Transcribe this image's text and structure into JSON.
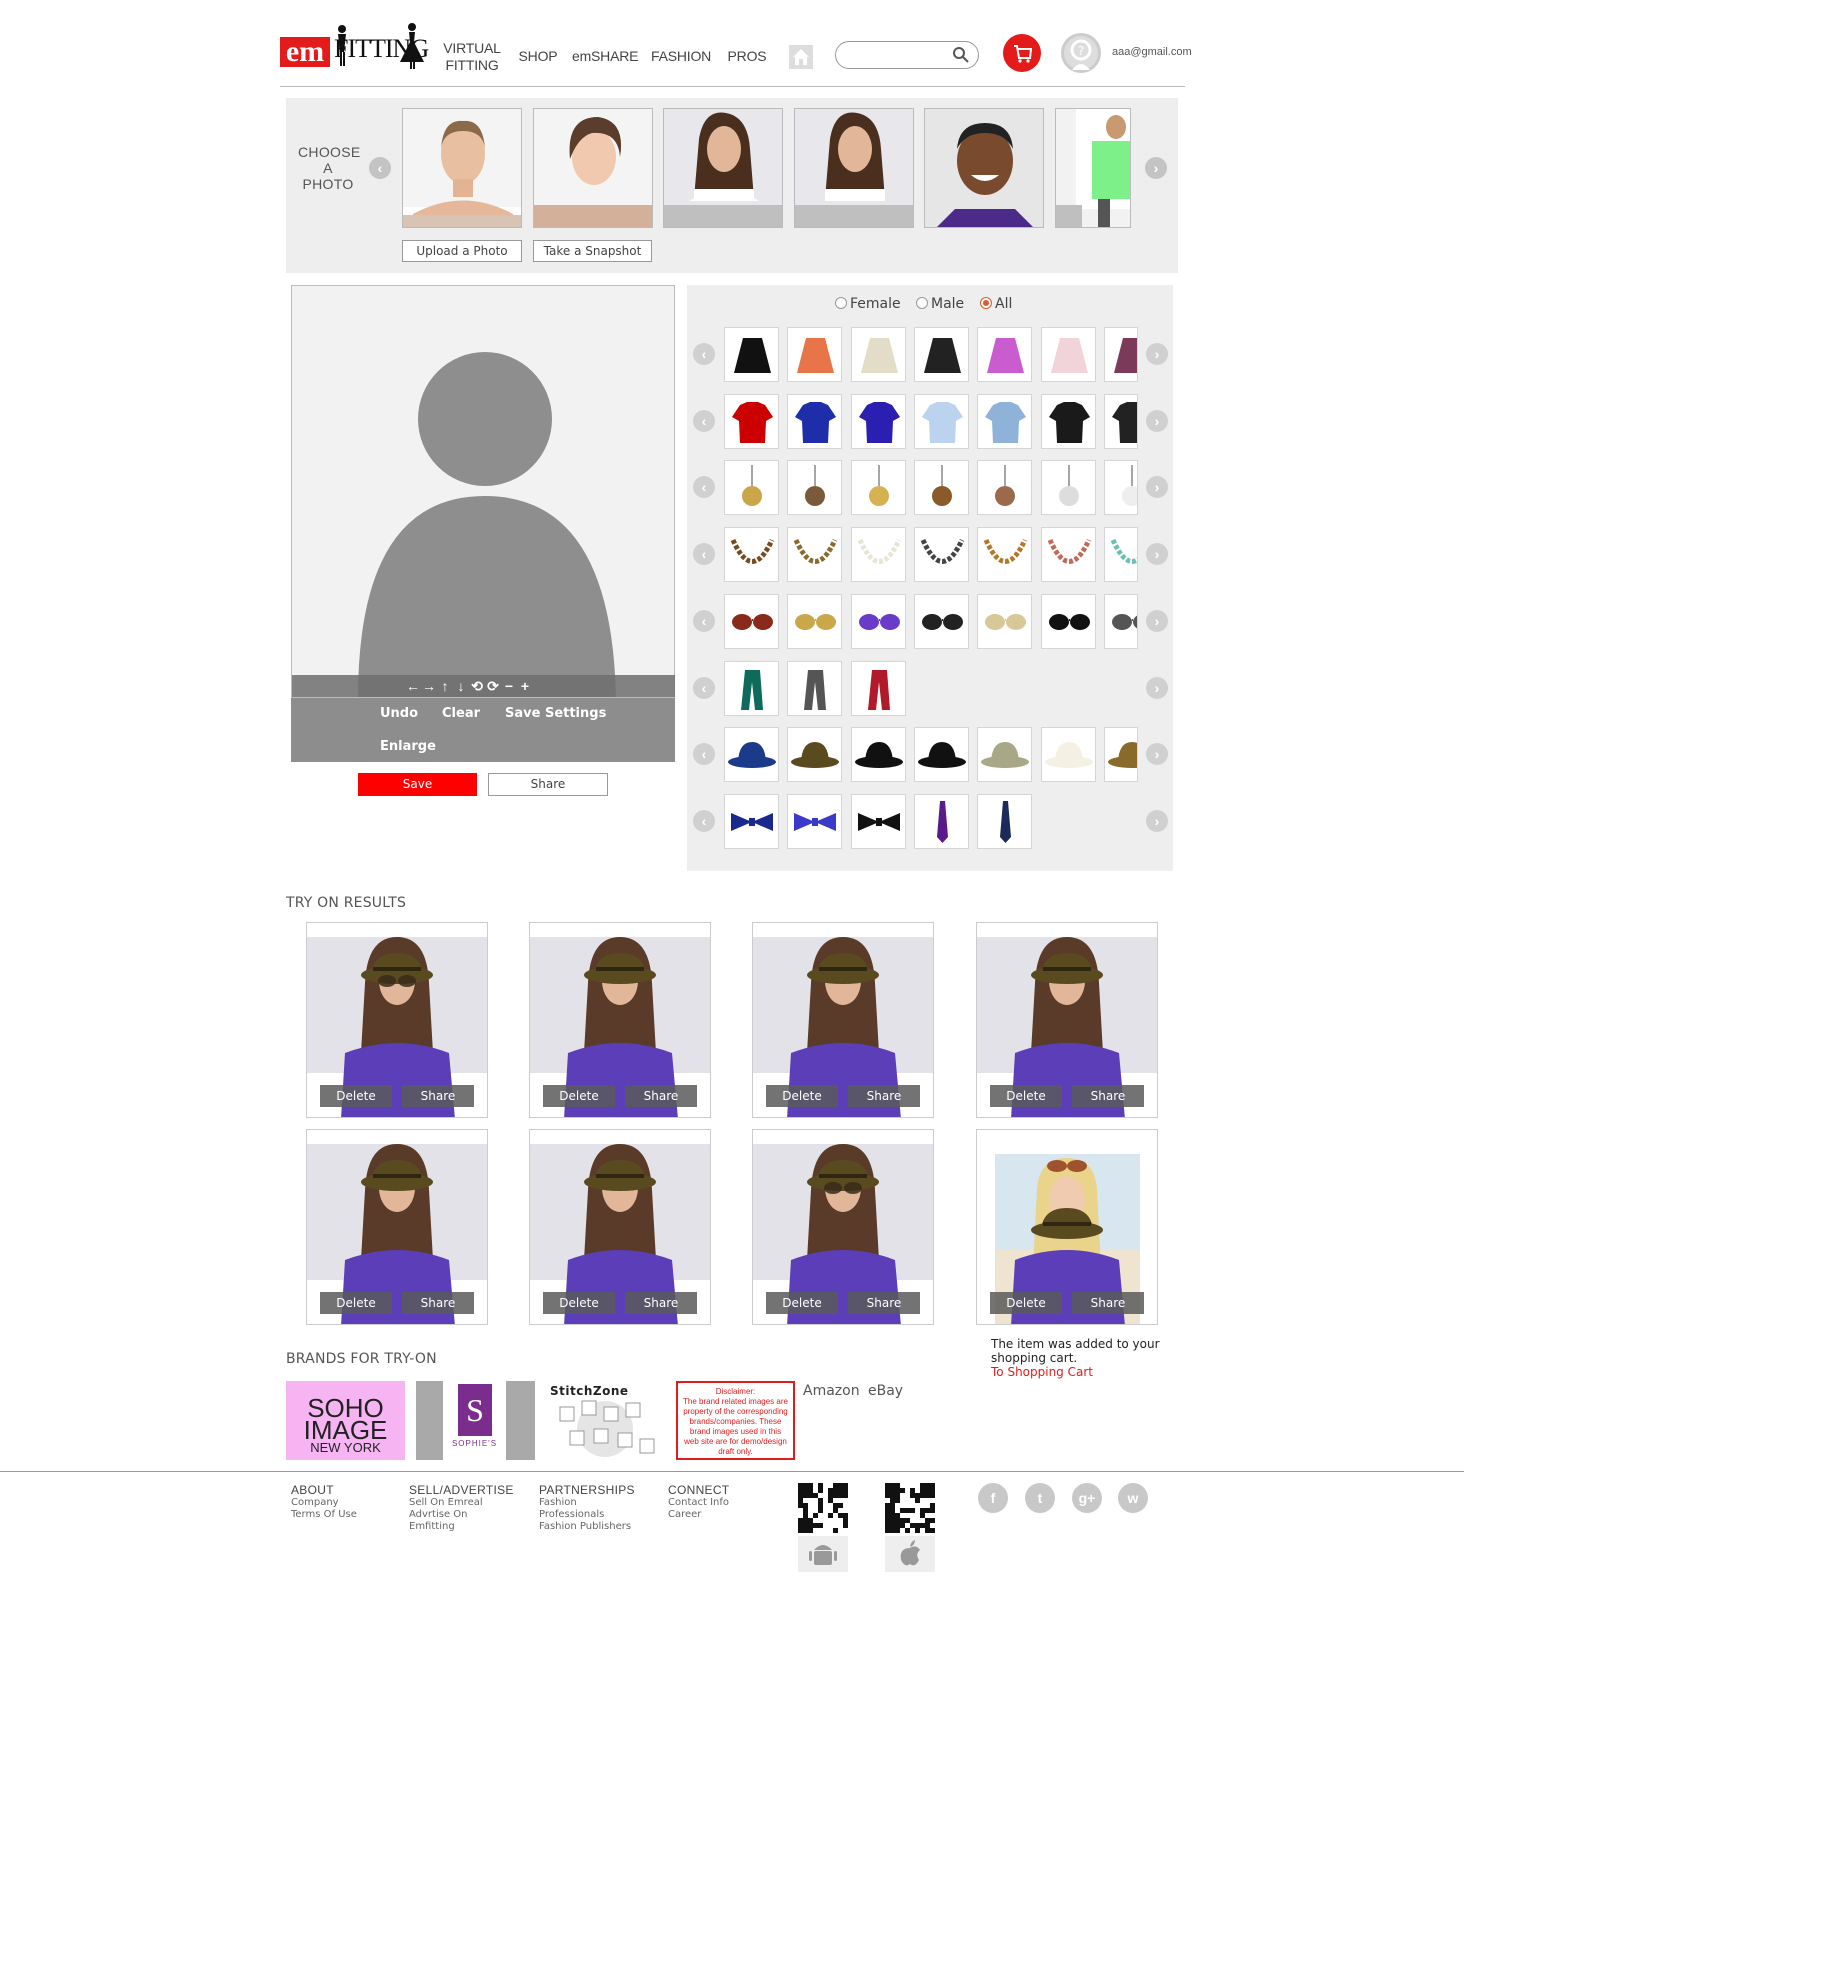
{
  "header": {
    "logo_em": "em",
    "logo_fitting": "FITTING",
    "nav": [
      {
        "label_line1": "VIRTUAL",
        "label_line2": "FITTING"
      },
      {
        "label_line1": "SHOP",
        "label_line2": ""
      },
      {
        "label_line1": "emSHARE",
        "label_line2": ""
      },
      {
        "label_line1": "FASHION",
        "label_line2": ""
      },
      {
        "label_line1": "PROS",
        "label_line2": ""
      }
    ],
    "search_placeholder": "",
    "user_email": "aaa@gmail.com",
    "icons": {
      "home": "home-icon",
      "search": "search-icon",
      "cart": "cart-icon",
      "avatar": "user-icon"
    }
  },
  "photo_chooser": {
    "label_line1": "CHOOSE",
    "label_line2": "A",
    "label_line3": "PHOTO",
    "upload_label": "Upload a Photo",
    "snapshot_label": "Take a Snapshot",
    "photos": [
      "woman-portrait",
      "woman-short-hair",
      "woman-long-hair",
      "woman-long-hair-2",
      "man-smiling",
      "man-green-shirt"
    ]
  },
  "canvas": {
    "placeholder": "person-silhouette",
    "tools": [
      "←",
      "→",
      "↑",
      "↓",
      "⟲",
      "⟳",
      "−",
      "+"
    ],
    "undo_label": "Undo",
    "clear_label": "Clear",
    "save_settings_label": "Save Settings",
    "enlarge_label": "Enlarge",
    "save_label": "Save",
    "share_label": "Share"
  },
  "catalog": {
    "gender_options": [
      {
        "label": "Female",
        "selected": false
      },
      {
        "label": "Male",
        "selected": false
      },
      {
        "label": "All",
        "selected": true
      }
    ],
    "rows": [
      {
        "category": "skirts",
        "items": [
          "black-skirt",
          "orange-floral-skirt",
          "lace-skirt",
          "black-pleated-skirt",
          "striped-skirt",
          "pink-floral-skirt",
          "patterned-skirt"
        ]
      },
      {
        "category": "tops",
        "items": [
          "red-tshirt",
          "blue-jacket",
          "blue-top",
          "light-blue-shirt",
          "blue-denim-shirt",
          "black-suit",
          "black-suit-2"
        ]
      },
      {
        "category": "earrings",
        "items": [
          "gold-pearl-earring",
          "bronze-pearl-earring",
          "gold-pearl-earring-2",
          "bronze-pearl-earring-2",
          "copper-pearl-earring",
          "white-pearl-earring",
          "pearl-drop-earring"
        ]
      },
      {
        "category": "necklaces",
        "items": [
          "brown-bead-necklace",
          "bronze-bead-necklace",
          "pearl-necklace",
          "jeweled-necklace",
          "gold-flower-necklace",
          "pink-stone-necklace",
          "turquoise-necklace"
        ]
      },
      {
        "category": "sunglasses",
        "items": [
          "tortoise-sunglasses",
          "aviator-sunglasses",
          "purple-sunglasses",
          "black-cat-eye-sunglasses",
          "white-sunglasses",
          "black-sunglasses",
          "studded-sunglasses"
        ]
      },
      {
        "category": "scarves",
        "items": [
          "green-plaid-scarf",
          "grey-scarf",
          "red-plaid-scarf"
        ]
      },
      {
        "category": "hats",
        "items": [
          "blue-cap",
          "olive-porkpie-hat",
          "black-chanel-cap",
          "black-wide-brim-hat",
          "beige-sun-hat",
          "white-fedora",
          "straw-fedora"
        ]
      },
      {
        "category": "ties",
        "items": [
          "flag-bow-tie",
          "plaid-bow-tie",
          "black-bow-tie",
          "purple-tie",
          "navy-tie"
        ]
      }
    ]
  },
  "results": {
    "title": "TRY ON RESULTS",
    "delete_label": "Delete",
    "share_label": "Share",
    "cards": [
      "woman-olive-hat-sunglasses",
      "woman-olive-hat",
      "woman-olive-hat",
      "woman-olive-hat",
      "woman-olive-hat",
      "woman-olive-hat",
      "woman-olive-hat-sunglasses",
      "blonde-olive-hat-sunglasses"
    ],
    "cart_message": "The item was added to your shopping cart.",
    "cart_link": "To Shopping Cart"
  },
  "brands": {
    "title": "BRANDS FOR TRY-ON",
    "soho_line1": "SOHO",
    "soho_line2": "IMAGE",
    "soho_line3": "NEW YORK",
    "sophies_mark": "S",
    "sophies_name": "SOPHIE'S",
    "stitchzone": "StitchZone",
    "disclaimer_title": "Disclaimer:",
    "disclaimer_text": "The brand related images are property of the corresponding brands/companies. These brand images used in this web site are for demo/design draft only.",
    "amazon": "Amazon",
    "ebay": "eBay"
  },
  "footer": {
    "columns": [
      {
        "heading": "ABOUT",
        "links": [
          "Company",
          "Terms Of Use"
        ]
      },
      {
        "heading": "SELL/ADVERTISE",
        "links": [
          "Sell On Emreal",
          "Advrtise On",
          "Emfitting"
        ]
      },
      {
        "heading": "PARTNERSHIPS",
        "links": [
          "Fashion",
          "Professionals",
          "Fashion Publishers"
        ]
      },
      {
        "heading": "CONNECT",
        "links": [
          "Contact Info",
          "Career"
        ]
      }
    ],
    "social": [
      "facebook-icon",
      "twitter-icon",
      "google-plus-icon",
      "wechat-icon"
    ],
    "social_glyphs": [
      "f",
      "t",
      "g+",
      "w"
    ]
  },
  "colors": {
    "accent": "#e31b1b",
    "panel": "#eeeeee",
    "dark_panel": "#8d8d8d",
    "result_top": "#5b3eb8"
  }
}
